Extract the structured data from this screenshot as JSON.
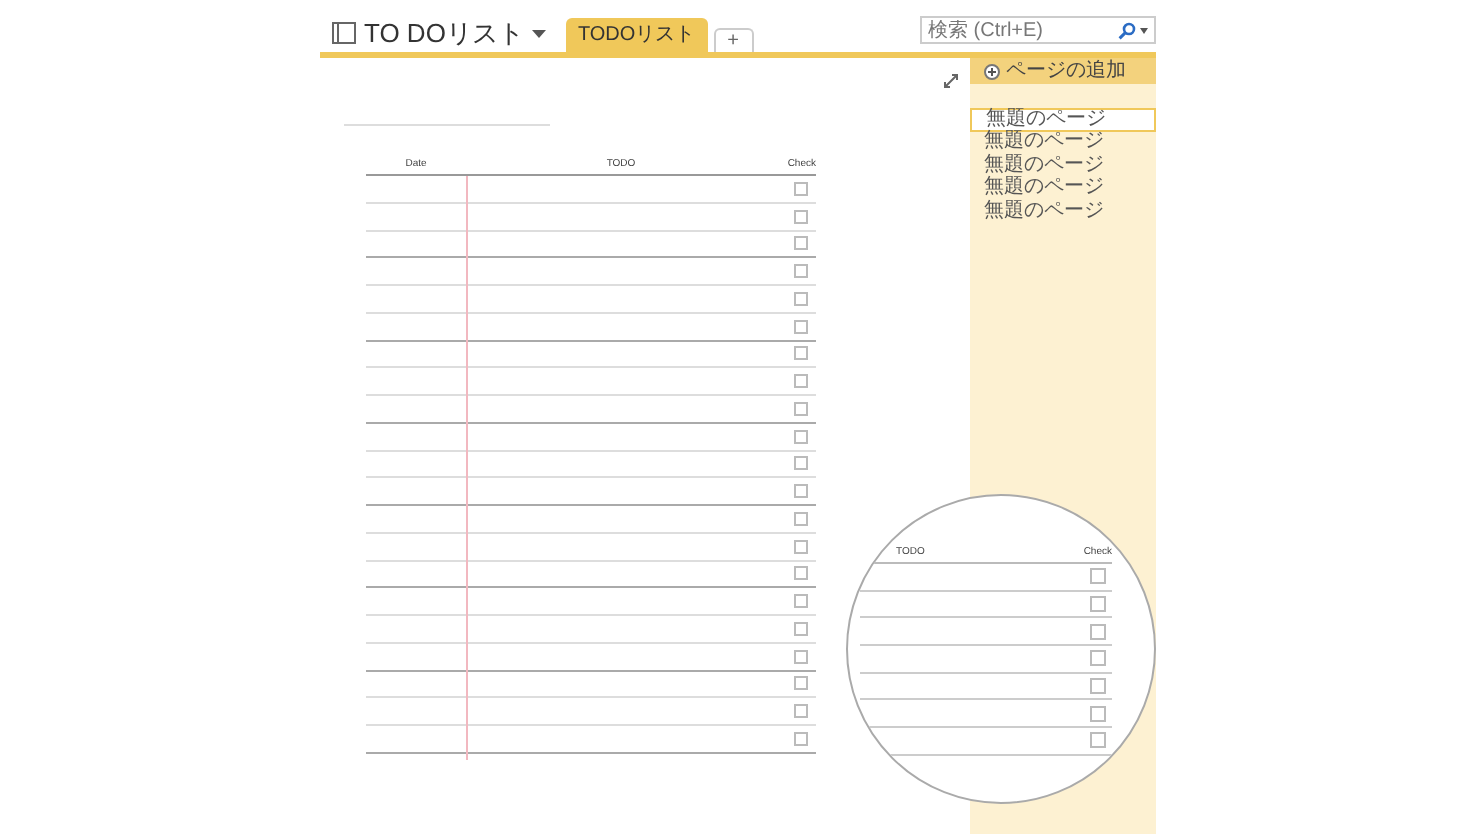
{
  "notebook": {
    "title": "TO DOリスト"
  },
  "tabs": [
    {
      "label": "TODOリスト",
      "selected": true
    },
    {
      "label": "+",
      "selected": false
    }
  ],
  "search": {
    "placeholder": "検索 (Ctrl+E)"
  },
  "sidebar": {
    "add_page": "ページの追加",
    "pages": [
      {
        "label": "無題のページ",
        "selected": true
      },
      {
        "label": "無題のページ",
        "selected": false
      },
      {
        "label": "無題のページ",
        "selected": false
      },
      {
        "label": "無題のページ",
        "selected": false
      },
      {
        "label": "無題のページ",
        "selected": false
      }
    ]
  },
  "table": {
    "columns": [
      "Date",
      "TODO",
      "Check"
    ],
    "rows": [
      {
        "checked": false
      },
      {
        "checked": false
      },
      {
        "checked": false
      },
      {
        "checked": false
      },
      {
        "checked": false
      },
      {
        "checked": false
      },
      {
        "checked": false
      },
      {
        "checked": false
      },
      {
        "checked": false
      },
      {
        "checked": false
      },
      {
        "checked": false
      },
      {
        "checked": false
      },
      {
        "checked": false
      },
      {
        "checked": false
      },
      {
        "checked": false
      },
      {
        "checked": false
      },
      {
        "checked": false
      },
      {
        "checked": false
      },
      {
        "checked": false
      },
      {
        "checked": false
      },
      {
        "checked": false
      }
    ]
  },
  "magnifier": {
    "columns": [
      "TODO",
      "Check"
    ],
    "rows": [
      {
        "checked": false
      },
      {
        "checked": false
      },
      {
        "checked": false
      },
      {
        "checked": false
      },
      {
        "checked": false
      },
      {
        "checked": false
      },
      {
        "checked": false
      }
    ]
  }
}
